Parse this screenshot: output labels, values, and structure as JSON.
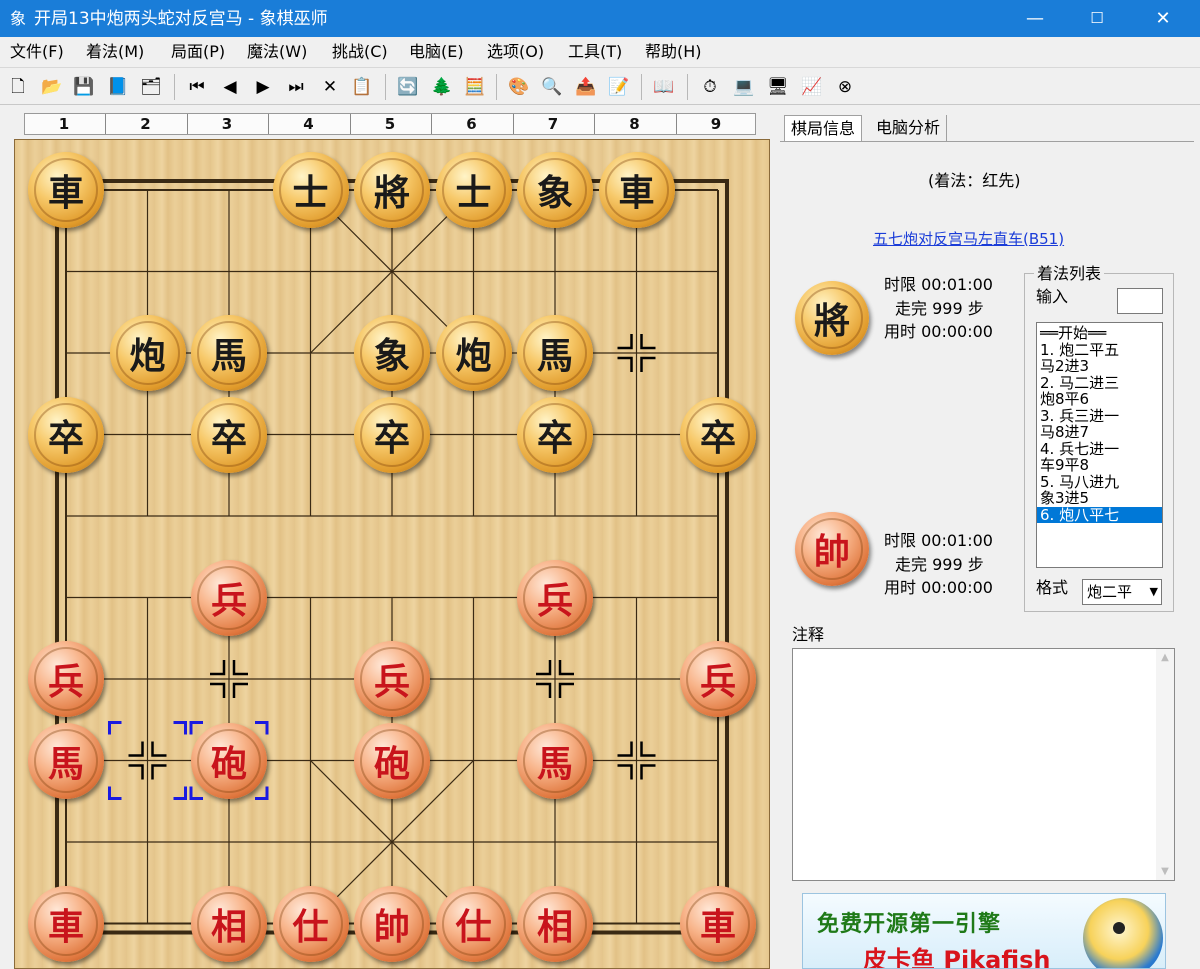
{
  "window": {
    "app_icon": "象",
    "title": "开局13中炮两头蛇对反宫马 - 象棋巫师",
    "controls": [
      "—",
      "☐",
      "✕"
    ]
  },
  "menu": [
    "文件(F)",
    "着法(M)",
    "局面(P)",
    "魔法(W)",
    "挑战(C)",
    "电脑(E)",
    "选项(O)",
    "工具(T)",
    "帮助(H)"
  ],
  "toolbar": {
    "buttons": [
      {
        "name": "new-file-icon",
        "glyph": "🗋"
      },
      {
        "name": "open-folder-icon",
        "glyph": "📂"
      },
      {
        "name": "save-disk-icon",
        "glyph": "💾"
      },
      {
        "name": "book-icon",
        "glyph": "📘"
      },
      {
        "name": "properties-icon",
        "glyph": "🗂"
      },
      {
        "name": "first-move-icon",
        "glyph": "⏮"
      },
      {
        "name": "previous-move-icon",
        "glyph": "◀"
      },
      {
        "name": "next-move-icon",
        "glyph": "▶"
      },
      {
        "name": "last-move-icon",
        "glyph": "⏭"
      },
      {
        "name": "delete-icon",
        "glyph": "✕"
      },
      {
        "name": "paste-icon",
        "glyph": "📋"
      },
      {
        "name": "flip-board-icon",
        "glyph": "🔄"
      },
      {
        "name": "move-tree-icon",
        "glyph": "🌲"
      },
      {
        "name": "calculator-icon",
        "glyph": "🧮"
      },
      {
        "name": "color-wheel-icon",
        "glyph": "🎨"
      },
      {
        "name": "search-book-icon",
        "glyph": "🔍"
      },
      {
        "name": "export-icon",
        "glyph": "📤"
      },
      {
        "name": "edit-board-icon",
        "glyph": "📝"
      },
      {
        "name": "opening-book-icon",
        "glyph": "📖"
      },
      {
        "name": "clock-icon",
        "glyph": "⏱"
      },
      {
        "name": "computer-icon",
        "glyph": "💻"
      },
      {
        "name": "computer2-icon",
        "glyph": "🖥"
      },
      {
        "name": "monitor-icon",
        "glyph": "📈"
      },
      {
        "name": "stop-icon",
        "glyph": "⊗"
      }
    ]
  },
  "ruler": [
    "1",
    "2",
    "3",
    "4",
    "5",
    "6",
    "7",
    "8",
    "9"
  ],
  "board": {
    "pieces": [
      {
        "side": "black",
        "char": "車",
        "file": 1,
        "rank": 0
      },
      {
        "side": "black",
        "char": "士",
        "file": 4,
        "rank": 0
      },
      {
        "side": "black",
        "char": "將",
        "file": 5,
        "rank": 0
      },
      {
        "side": "black",
        "char": "士",
        "file": 6,
        "rank": 0
      },
      {
        "side": "black",
        "char": "象",
        "file": 7,
        "rank": 0
      },
      {
        "side": "black",
        "char": "車",
        "file": 8,
        "rank": 0
      },
      {
        "side": "black",
        "char": "炮",
        "file": 2,
        "rank": 2
      },
      {
        "side": "black",
        "char": "馬",
        "file": 3,
        "rank": 2
      },
      {
        "side": "black",
        "char": "象",
        "file": 5,
        "rank": 2
      },
      {
        "side": "black",
        "char": "炮",
        "file": 6,
        "rank": 2
      },
      {
        "side": "black",
        "char": "馬",
        "file": 7,
        "rank": 2
      },
      {
        "side": "black",
        "char": "卒",
        "file": 1,
        "rank": 3
      },
      {
        "side": "black",
        "char": "卒",
        "file": 3,
        "rank": 3
      },
      {
        "side": "black",
        "char": "卒",
        "file": 5,
        "rank": 3
      },
      {
        "side": "black",
        "char": "卒",
        "file": 7,
        "rank": 3
      },
      {
        "side": "black",
        "char": "卒",
        "file": 9,
        "rank": 3
      },
      {
        "side": "red",
        "char": "兵",
        "file": 3,
        "rank": 5
      },
      {
        "side": "red",
        "char": "兵",
        "file": 7,
        "rank": 5
      },
      {
        "side": "red",
        "char": "兵",
        "file": 1,
        "rank": 6
      },
      {
        "side": "red",
        "char": "兵",
        "file": 5,
        "rank": 6
      },
      {
        "side": "red",
        "char": "兵",
        "file": 9,
        "rank": 6
      },
      {
        "side": "red",
        "char": "馬",
        "file": 1,
        "rank": 7
      },
      {
        "side": "red",
        "char": "砲",
        "file": 3,
        "rank": 7
      },
      {
        "side": "red",
        "char": "砲",
        "file": 5,
        "rank": 7
      },
      {
        "side": "red",
        "char": "馬",
        "file": 7,
        "rank": 7
      },
      {
        "side": "red",
        "char": "車",
        "file": 1,
        "rank": 9
      },
      {
        "side": "red",
        "char": "相",
        "file": 3,
        "rank": 9
      },
      {
        "side": "red",
        "char": "仕",
        "file": 4,
        "rank": 9
      },
      {
        "side": "red",
        "char": "帥",
        "file": 5,
        "rank": 9
      },
      {
        "side": "red",
        "char": "仕",
        "file": 6,
        "rank": 9
      },
      {
        "side": "red",
        "char": "相",
        "file": 7,
        "rank": 9
      },
      {
        "side": "red",
        "char": "車",
        "file": 9,
        "rank": 9
      }
    ],
    "empty_markers": [
      {
        "file": 8,
        "rank": 2
      },
      {
        "file": 3,
        "rank": 6
      },
      {
        "file": 7,
        "rank": 6
      },
      {
        "file": 2,
        "rank": 7
      },
      {
        "file": 8,
        "rank": 7
      }
    ],
    "last_move": {
      "from": {
        "file": 2,
        "rank": 7
      },
      "to": {
        "file": 3,
        "rank": 7
      }
    }
  },
  "tabs": [
    "棋局信息",
    "电脑分析"
  ],
  "info": {
    "move_label": "(着法：红先)",
    "opening_link": "五七炮对反宫马左直车(B51)",
    "black": {
      "piece": "將",
      "time_limit": "时限  00:01:00",
      "moves_done": "走完  999  步",
      "time_used": "用时  00:00:00"
    },
    "red": {
      "piece": "帥",
      "time_limit": "时限  00:01:00",
      "moves_done": "走完  999  步",
      "time_used": "用时  00:00:00"
    }
  },
  "movelist": {
    "title": "着法列表",
    "input_label": "输入",
    "items": [
      "══开始══",
      "1. 炮二平五",
      "   马2进3",
      "2. 马二进三",
      "   炮8平6",
      "3. 兵三进一",
      "   马8进7",
      "4. 兵七进一",
      "   车9平8",
      "5. 马八进九",
      "   象3进5",
      "6. 炮八平七"
    ],
    "selected_index": 11,
    "format_label": "格式",
    "format_value": "炮二平"
  },
  "comment": {
    "label": "注释"
  },
  "banner": {
    "line1": "免费开源第一引擎",
    "line2": "皮卡鱼 Pikafish"
  }
}
